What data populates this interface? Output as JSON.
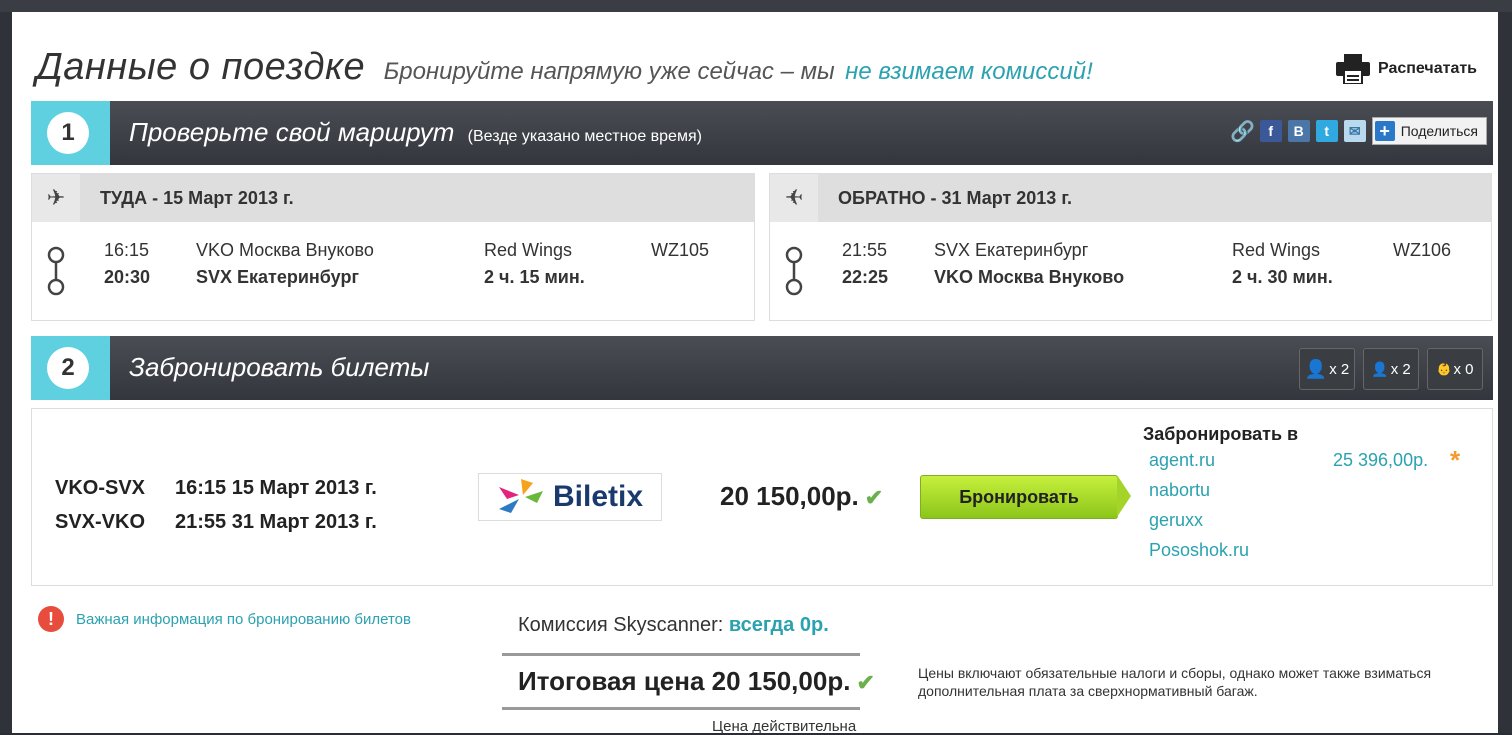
{
  "header": {
    "title": "Данные о поездке",
    "subtitle": "Бронируйте напрямую уже сейчас – мы",
    "subtitle_accent": "не взимаем комиссий!",
    "print_label": "Распечатать"
  },
  "step1": {
    "number": "1",
    "title": "Проверьте свой маршрут",
    "note": "(Везде указано местное время)",
    "share_label": "Поделиться",
    "share_icons": [
      "link-icon",
      "facebook-icon",
      "vkontakte-icon",
      "twitter-icon",
      "email-icon"
    ]
  },
  "outbound": {
    "header": "ТУДА - 15 Март 2013 г.",
    "depart_time": "16:15",
    "arrive_time": "20:30",
    "from": "VKO Москва Внуково",
    "to": "SVX Екатеринбург",
    "airline": "Red Wings",
    "duration": "2 ч. 15 мин.",
    "flight_no": "WZ105"
  },
  "inbound": {
    "header": "ОБРАТНО - 31 Март 2013 г.",
    "depart_time": "21:55",
    "arrive_time": "22:25",
    "from": "SVX Екатеринбург",
    "to": "VKO Москва Внуково",
    "airline": "Red Wings",
    "duration": "2 ч. 30 мин.",
    "flight_no": "WZ106"
  },
  "step2": {
    "number": "2",
    "title": "Забронировать билеты",
    "passengers": [
      {
        "icon": "adult-icon",
        "count": "x 2"
      },
      {
        "icon": "child-icon",
        "count": "x 2"
      },
      {
        "icon": "infant-icon",
        "count": "x 0"
      }
    ]
  },
  "booking": {
    "leg1_route": "VKO-SVX",
    "leg1_time": "16:15 15 Март 2013 г.",
    "leg2_route": "SVX-VKO",
    "leg2_time": "21:55 31 Март 2013 г.",
    "provider": "Biletix",
    "price": "20 150,00р.",
    "book_button": "Бронировать",
    "book_at_label": "Забронировать в",
    "agents": [
      "agent.ru",
      "nabortu",
      "geruxx",
      "Pososhok.ru"
    ],
    "agent_price": "25 396,00р.",
    "star": "*"
  },
  "footer": {
    "info_link": "Важная информация по бронированию билетов",
    "commission_label": "Комиссия Skyscanner:",
    "commission_value": "всегда 0р.",
    "total_label": "Итоговая цена 20 150,00р.",
    "tax_note": "Цены включают обязательные налоги и сборы, однако может также взиматься дополнительная плата за сверхнормативный багаж.",
    "valid_note": "Цена действительна"
  },
  "colors": {
    "accent": "#2ba2b0",
    "step_box": "#5fd0e0",
    "book_button": "#a4d42a"
  }
}
